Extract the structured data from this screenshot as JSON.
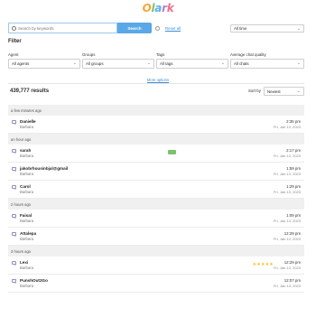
{
  "logo": {
    "text": "Olark"
  },
  "search": {
    "placeholder": "Search by keywords",
    "button_label": "Search",
    "reset_label": "Reset all"
  },
  "time_filter": {
    "value": "All time"
  },
  "filter": {
    "title": "Filter",
    "fields": [
      {
        "label": "Agent",
        "value": "All agents"
      },
      {
        "label": "Groups",
        "value": "All groups"
      },
      {
        "label": "Tags",
        "value": "All tags"
      },
      {
        "label": "Average chat quality",
        "value": "All chats"
      }
    ],
    "more_options": "More options"
  },
  "results": {
    "count_text": "439,777 results",
    "sort_label": "Sort by",
    "sort_value": "Newest"
  },
  "groups": [
    {
      "header": "a few minutes ago",
      "rows": [
        {
          "name": "Danielle",
          "sub": "Barbara",
          "time": "2:35 pm",
          "date": "Fri, Jan 13, 2023"
        }
      ]
    },
    {
      "header": "an hour ago",
      "rows": [
        {
          "name": "sarah",
          "sub": "Barbara",
          "time": "2:17 pm",
          "date": "Fri, Jan 13, 2023",
          "badge": true
        },
        {
          "name": "jakobrhousinbjal@gmail",
          "sub": "Barbara",
          "time": "1:59 pm",
          "date": "Fri, Jan 13, 2023"
        },
        {
          "name": "Carol",
          "sub": "Barbara",
          "time": "1:29 pm",
          "date": "Fri, Jan 13, 2023"
        }
      ]
    },
    {
      "header": "2 hours ago",
      "rows": [
        {
          "name": "Faisal",
          "sub": "Barbara",
          "time": "1:09 pm",
          "date": "Fri, Jan 13, 2023"
        },
        {
          "name": "Attalepa",
          "sub": "Barbara",
          "time": "12:29 pm",
          "date": "Fri, Jan 13, 2023"
        }
      ]
    },
    {
      "header": "3 hours ago",
      "rows": [
        {
          "name": "Lexi",
          "sub": "Barbara",
          "time": "12:29 pm",
          "date": "Fri, Jan 13, 2023",
          "stars": "★★★★★"
        },
        {
          "name": "PunshOut2Go",
          "sub": "Barbara",
          "time": "12:07 pm",
          "date": "Fri, Jan 13, 2023"
        }
      ]
    }
  ],
  "colors": {
    "accent": "#5aa8e6",
    "link": "#3d8ed8",
    "star": "#f4c21e",
    "badge": "#7ac26c"
  }
}
